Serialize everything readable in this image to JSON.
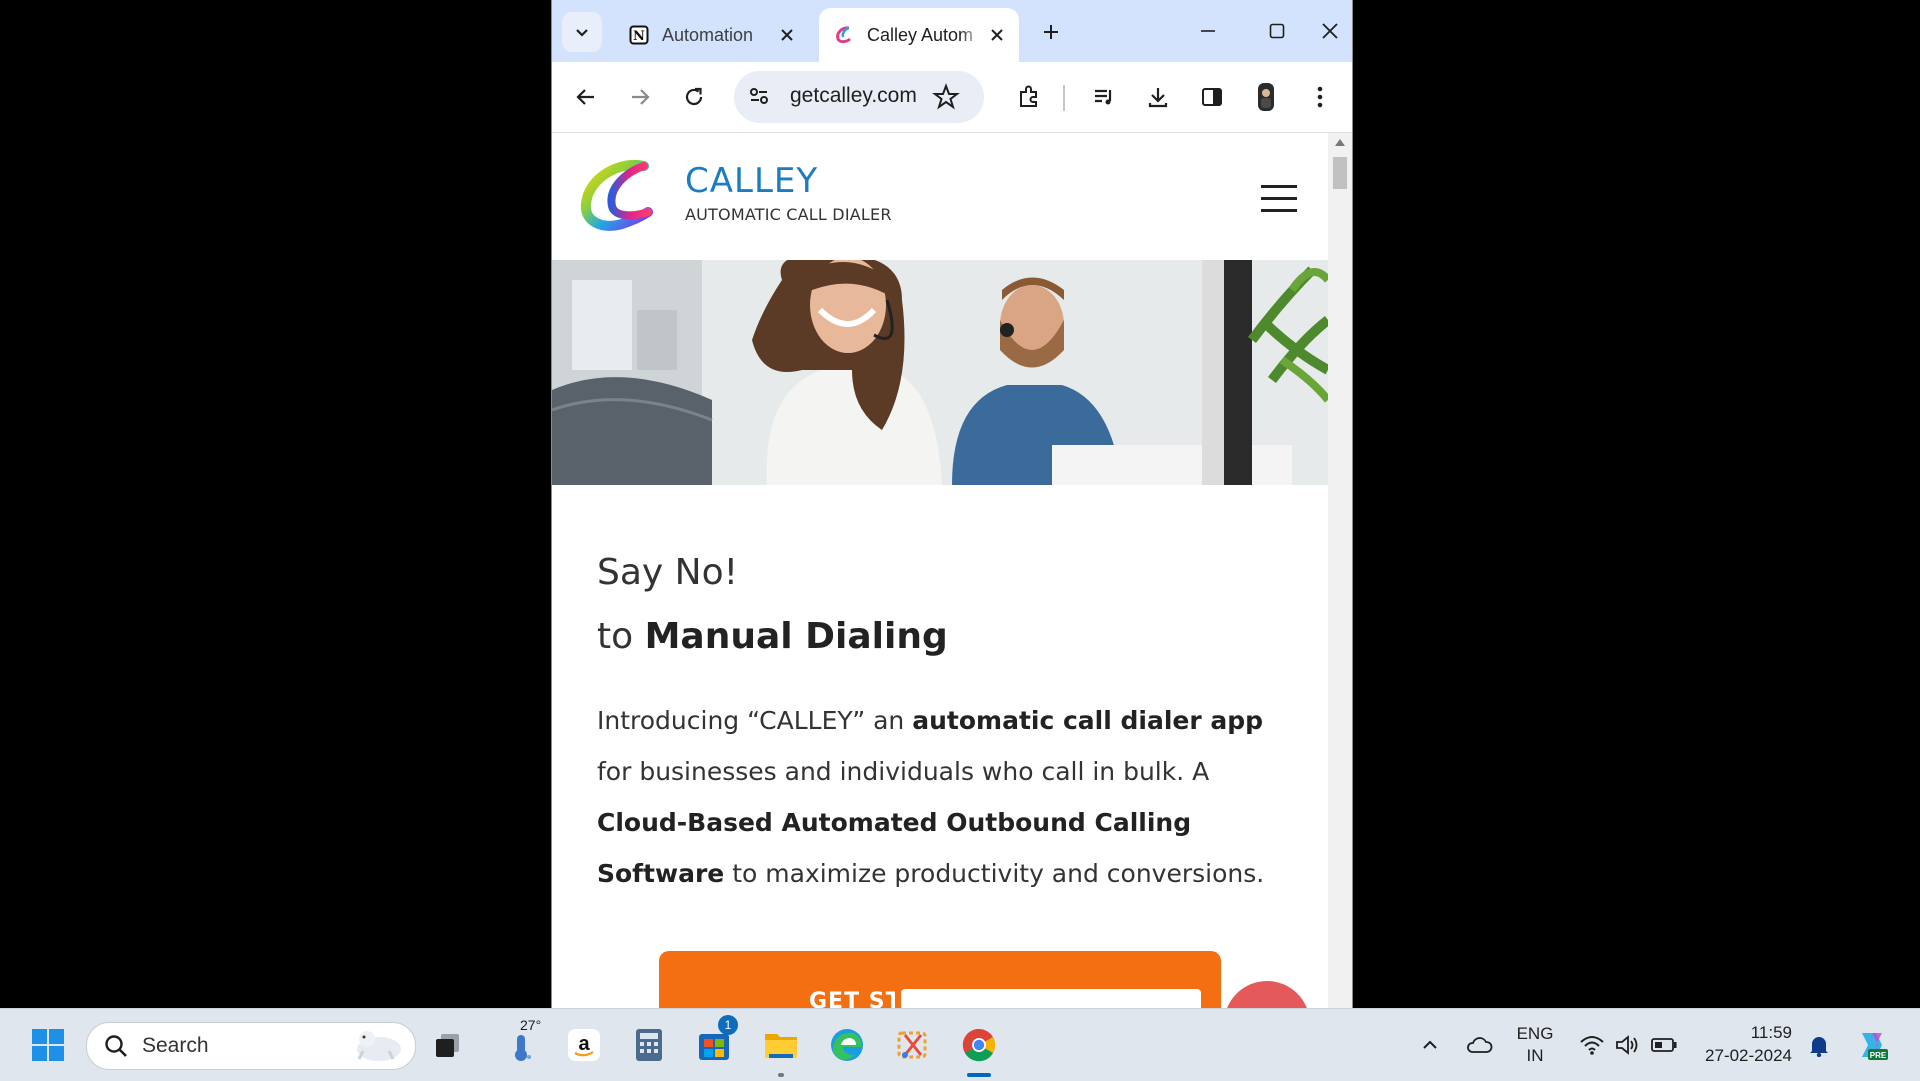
{
  "browser": {
    "tabs": [
      {
        "title": "Automation",
        "favicon": "notion-icon"
      },
      {
        "title": "Calley Autom",
        "favicon": "calley-icon"
      }
    ],
    "address": "getcalley.com"
  },
  "site": {
    "logo": {
      "name": "CALLEY",
      "tagline": "AUTOMATIC CALL DIALER"
    },
    "headline_line1": "Say No!",
    "headline_line2_prefix": "to ",
    "headline_line2_bold": "Manual Dialing",
    "intro": {
      "t1": "Introducing “CALLEY” an ",
      "b1": "automatic call dialer app",
      "t2": " for businesses and individuals who call in bulk. A ",
      "b2": "Cloud-Based Automated Outbound Calling Software",
      "t3": " to maximize productivity and conversions."
    },
    "cta_label": "GET STARTED",
    "colors": {
      "brand_blue": "#1b7cc3",
      "cta_orange": "#f46f11"
    }
  },
  "taskbar": {
    "search_placeholder": "Search",
    "weather": "27°",
    "store_badge": "1",
    "lang_line1": "ENG",
    "lang_line2": "IN",
    "time": "11:59",
    "date": "27-02-2024"
  }
}
